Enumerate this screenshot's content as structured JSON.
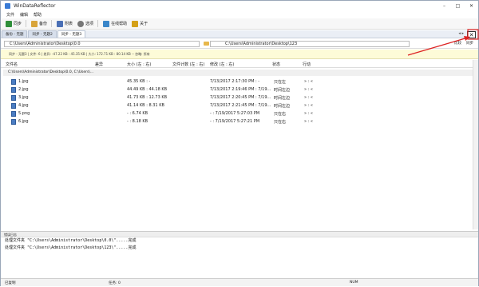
{
  "title": "WinDataReflector",
  "window_buttons": [
    "–",
    "□",
    "✕"
  ],
  "menu": [
    "文件",
    "编辑",
    "帮助"
  ],
  "toolbar": [
    {
      "label": "同步",
      "icon": "sync-icon",
      "color": "#2f8f3a"
    },
    {
      "label": "备份",
      "icon": "backup-icon",
      "color": "#d9a53a"
    },
    {
      "label": "附表",
      "icon": "table-icon",
      "color": "#4a6fb5"
    },
    {
      "label": "选项",
      "icon": "gear-icon",
      "color": "#777777"
    },
    {
      "label": "在线帮助",
      "icon": "help-icon",
      "color": "#3a86c9"
    },
    {
      "label": "关于",
      "icon": "about-icon",
      "color": "#d4a017"
    }
  ],
  "tabs": [
    {
      "label": "备份 - 无题",
      "active": false
    },
    {
      "label": "同步 - 无题2",
      "active": false
    },
    {
      "label": "同步 - 无题3",
      "active": true
    }
  ],
  "tab_arrows": "◂ ▸",
  "close_symbol": "✕",
  "path_left": "C:\\Users\\Administrator\\Desktop\\0.0",
  "path_right": "C:\\Users\\Administrator\\Desktop\\123",
  "path_buttons": [
    "比较",
    "同步"
  ],
  "status_line": "同步 - 无题3 | 文件: 6 | 差异: -47.22 KB : 45.35 KB | 大小: 172.71 KB : 80.14 KB -- 忽略: 所有",
  "columns": [
    "文件名",
    "差异",
    "大小 (左 : 右)",
    "文件计数 (左 : 右)",
    "修改 (左 : 右)",
    "状态",
    "行动"
  ],
  "root_path": "C:\\Users\\Administrator\\Desktop\\0.0, C:\\Users\\...",
  "files": [
    {
      "name": "1.jpg",
      "size": "45.35 KB : -",
      "modified": "7/13/2017 2:17:30 PM : -",
      "status": "只在左",
      "action": "» : «"
    },
    {
      "name": "2.jpg",
      "size": "44.49 KB : 44.18 KB",
      "modified": "7/13/2017 2:19:46 PM : 7/19...",
      "status": "时间左边",
      "action": "» : «"
    },
    {
      "name": "3.jpg",
      "size": "41.73 KB : 12.73 KB",
      "modified": "7/13/2017 2:20:45 PM : 7/19...",
      "status": "时间左边",
      "action": "» : «"
    },
    {
      "name": "4.jpg",
      "size": "41.14 KB : 8.31 KB",
      "modified": "7/13/2017 2:21:45 PM : 7/19...",
      "status": "时间左边",
      "action": "» : «"
    },
    {
      "name": "5.png",
      "size": "- : 6.74 KB",
      "modified": "- : 7/19/2017 5:27:03 PM",
      "status": "只在右",
      "action": "» : «"
    },
    {
      "name": "6.jpg",
      "size": "- : 8.18 KB",
      "modified": "- : 7/19/2017 5:27:21 PM",
      "status": "只在右",
      "action": "» : «"
    }
  ],
  "log_header": "错误日志",
  "log_lines": [
    "处理文件夹 \"C:\\Users\\Administrator\\Desktop\\0.0\\\".....完成",
    "处理文件夹 \"C:\\Users\\Administrator\\Desktop\\123\\\".....完成"
  ],
  "status_bar": {
    "left": "已复制",
    "mid": "任务: 0",
    "right": "NUM"
  }
}
